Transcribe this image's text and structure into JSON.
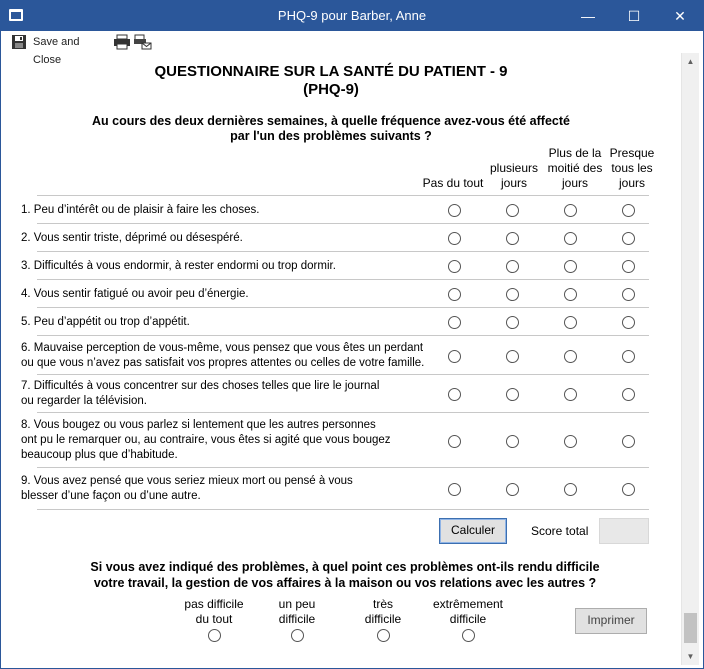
{
  "window": {
    "title": "PHQ-9 pour Barber, Anne",
    "minimize": "—",
    "maximize": "☐",
    "close": "✕"
  },
  "toolbar": {
    "save_close_label": "Save and Close"
  },
  "form": {
    "title_line1": "QUESTIONNAIRE SUR LA SANTÉ DU PATIENT - 9",
    "title_line2": "(PHQ-9)",
    "intro_line1": "Au cours des deux dernières semaines, à quelle fréquence avez-vous été affecté",
    "intro_line2": "par l'un des problèmes suivants ?",
    "columns": [
      {
        "line1": "",
        "line2": "",
        "line3": "Pas du tout"
      },
      {
        "line1": "",
        "line2": "plusieurs",
        "line3": "jours"
      },
      {
        "line1": "Plus de la",
        "line2": "moitié des",
        "line3": "jours"
      },
      {
        "line1": "Presque",
        "line2": "tous les",
        "line3": "jours"
      }
    ],
    "questions": [
      {
        "lines": [
          "1. Peu d’intérêt ou de plaisir à faire les choses."
        ]
      },
      {
        "lines": [
          "2. Vous sentir triste, déprimé ou désespéré."
        ]
      },
      {
        "lines": [
          "3. Difficultés à vous endormir, à rester endormi ou trop dormir."
        ]
      },
      {
        "lines": [
          "4. Vous sentir fatigué ou avoir peu d’énergie."
        ]
      },
      {
        "lines": [
          "5. Peu d’appétit ou trop d’appétit."
        ]
      },
      {
        "lines": [
          "6. Mauvaise perception de vous-même, vous pensez que vous êtes un perdant",
          "ou que vous n’avez pas satisfait vos propres attentes ou celles de votre famille."
        ]
      },
      {
        "lines": [
          "7. Difficultés à vous concentrer sur des choses telles que lire le journal",
          "ou regarder la télévision."
        ]
      },
      {
        "lines": [
          "8. Vous bougez ou vous parlez si lentement que les autres personnes",
          "ont pu le remarquer ou, au contraire, vous êtes si agité que vous bougez",
          "beaucoup plus que d’habitude."
        ]
      },
      {
        "lines": [
          "9. Vous avez pensé que vous seriez mieux mort ou pensé à vous",
          "blesser d’une façon ou d’une autre."
        ]
      }
    ],
    "calculate_label": "Calculer",
    "score_label": "Score total",
    "score_value": "",
    "difficulty_line1": "Si vous avez indiqué des problèmes, à quel point ces problèmes ont-ils rendu difficile",
    "difficulty_line2": "votre travail, la gestion de vos affaires à la maison ou vos relations avec les autres ?",
    "severity": [
      {
        "line1": "pas difficile",
        "line2": "du tout"
      },
      {
        "line1": "un peu",
        "line2": "difficile"
      },
      {
        "line1": "très",
        "line2": "difficile"
      },
      {
        "line1": "extrêmement",
        "line2": "difficile"
      }
    ],
    "print_label": "Imprimer"
  }
}
